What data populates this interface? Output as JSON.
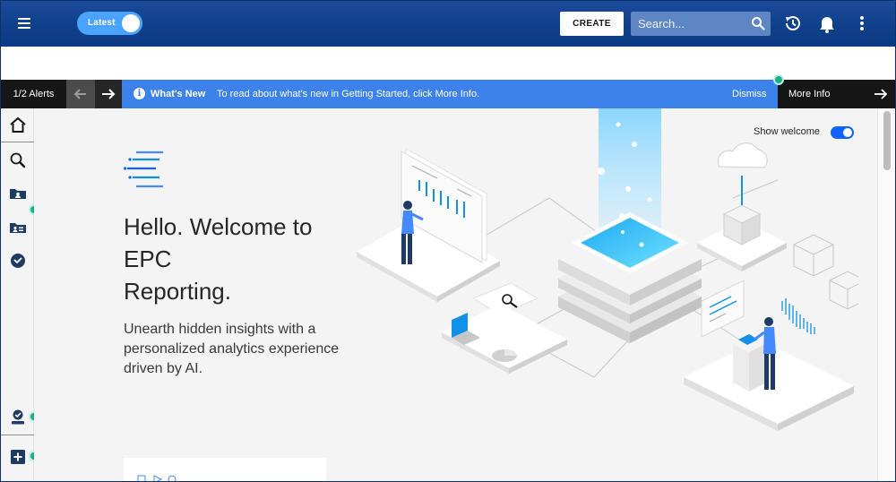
{
  "header": {
    "latest_toggle_label": "Latest",
    "create_label": "CREATE",
    "search_placeholder": "Search..."
  },
  "alert": {
    "count": "1/2 Alerts",
    "title": "What's New",
    "message": "To read about what's new in Getting Started, click More Info.",
    "dismiss": "Dismiss",
    "more_info": "More Info"
  },
  "welcome": {
    "show_welcome_label": "Show welcome",
    "title_line1": "Hello. Welcome to",
    "title_line2": "EPC",
    "title_line3": "Reporting.",
    "subtitle": "Unearth hidden insights with a personalized analytics experience driven by AI."
  },
  "sidebar": {
    "items": [
      "home-icon",
      "search-icon",
      "folder-icon",
      "shared-folder-icon",
      "recent-icon",
      "user-badge-icon",
      "new-icon"
    ]
  },
  "colors": {
    "header": "#0e3f8a",
    "alert_bar": "#3c82ea",
    "accent": "#0f62fe",
    "toggle": "#4aa3ff",
    "status_dot": "#24a98a"
  }
}
